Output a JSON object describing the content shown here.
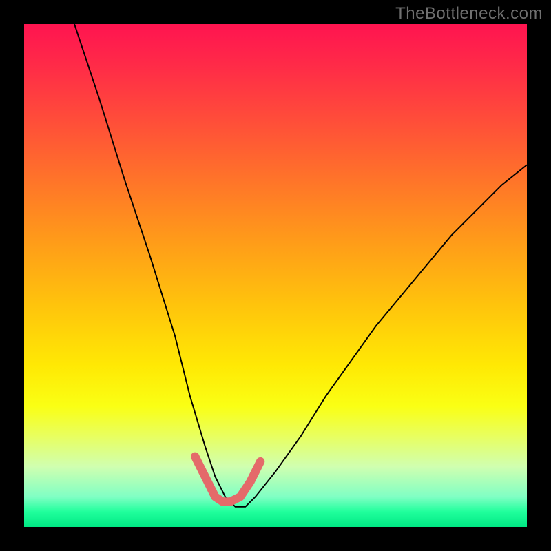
{
  "watermark": "TheBottleneck.com",
  "chart_data": {
    "type": "line",
    "title": "",
    "xlabel": "",
    "ylabel": "",
    "xlim": [
      0,
      100
    ],
    "ylim": [
      0,
      100
    ],
    "series": [
      {
        "name": "bottleneck-curve",
        "x": [
          10,
          15,
          20,
          25,
          30,
          33,
          36,
          38,
          40,
          42,
          44,
          46,
          50,
          55,
          60,
          65,
          70,
          75,
          80,
          85,
          90,
          95,
          100
        ],
        "values": [
          100,
          85,
          69,
          54,
          38,
          26,
          16,
          10,
          6,
          4,
          4,
          6,
          11,
          18,
          26,
          33,
          40,
          46,
          52,
          58,
          63,
          68,
          72
        ]
      },
      {
        "name": "trough-highlight",
        "x": [
          34,
          36,
          38,
          39.5,
          41,
          43,
          45,
          47
        ],
        "values": [
          14,
          10,
          6,
          5,
          5,
          6,
          9,
          13
        ]
      }
    ]
  }
}
